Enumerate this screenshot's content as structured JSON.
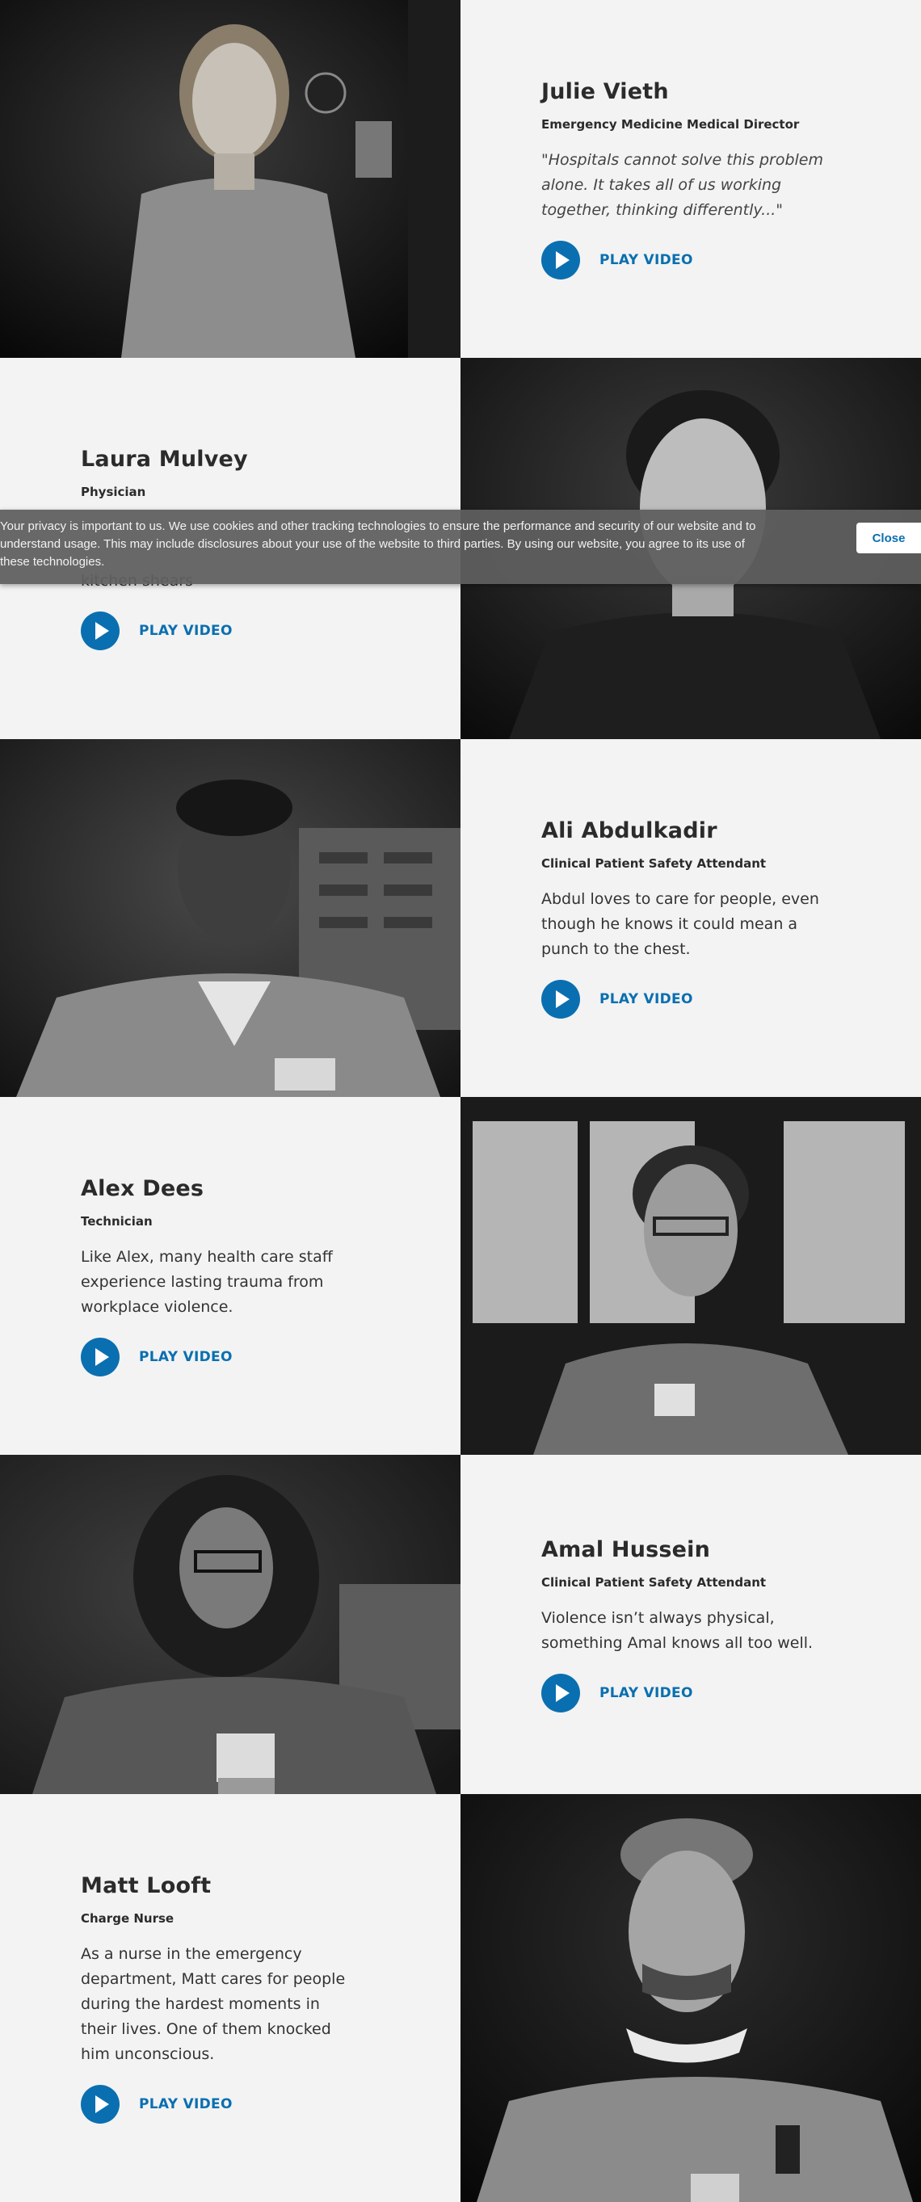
{
  "cookie_banner": {
    "text": "Your privacy is important to us. We use cookies and other tracking technologies to ensure the performance and security of our website and to understand usage. This may include disclosures about your use of the website to third parties. By using our website, you agree to its use of these technologies.",
    "close_label": "Close"
  },
  "profiles": [
    {
      "name": "Julie Vieth",
      "role": "Emergency Medicine Medical Director",
      "quote": "\"Hospitals cannot solve this problem alone. It takes all of us working together, thinking differently...\"",
      "cta": "PLAY VIDEO"
    },
    {
      "name": "Laura Mulvey",
      "role": "Physician",
      "quote": "kitchen shears",
      "cta": "PLAY VIDEO"
    },
    {
      "name": "Ali Abdulkadir",
      "role": "Clinical Patient Safety Attendant",
      "quote": "Abdul loves to care for people, even though he knows it could mean a punch to the chest.",
      "cta": "PLAY VIDEO"
    },
    {
      "name": "Alex Dees",
      "role": "Technician",
      "quote": "Like Alex, many health care staff experience lasting trauma from workplace violence.",
      "cta": "PLAY VIDEO"
    },
    {
      "name": "Amal Hussein",
      "role": "Clinical Patient Safety Attendant",
      "quote": "Violence isn’t always physical, something Amal knows all too well.",
      "cta": "PLAY VIDEO"
    },
    {
      "name": "Matt Looft",
      "role": "Charge Nurse",
      "quote": "As a nurse in the emergency department, Matt cares for people during the hardest moments in their lives. One of them knocked him unconscious.",
      "cta": "PLAY VIDEO"
    }
  ]
}
